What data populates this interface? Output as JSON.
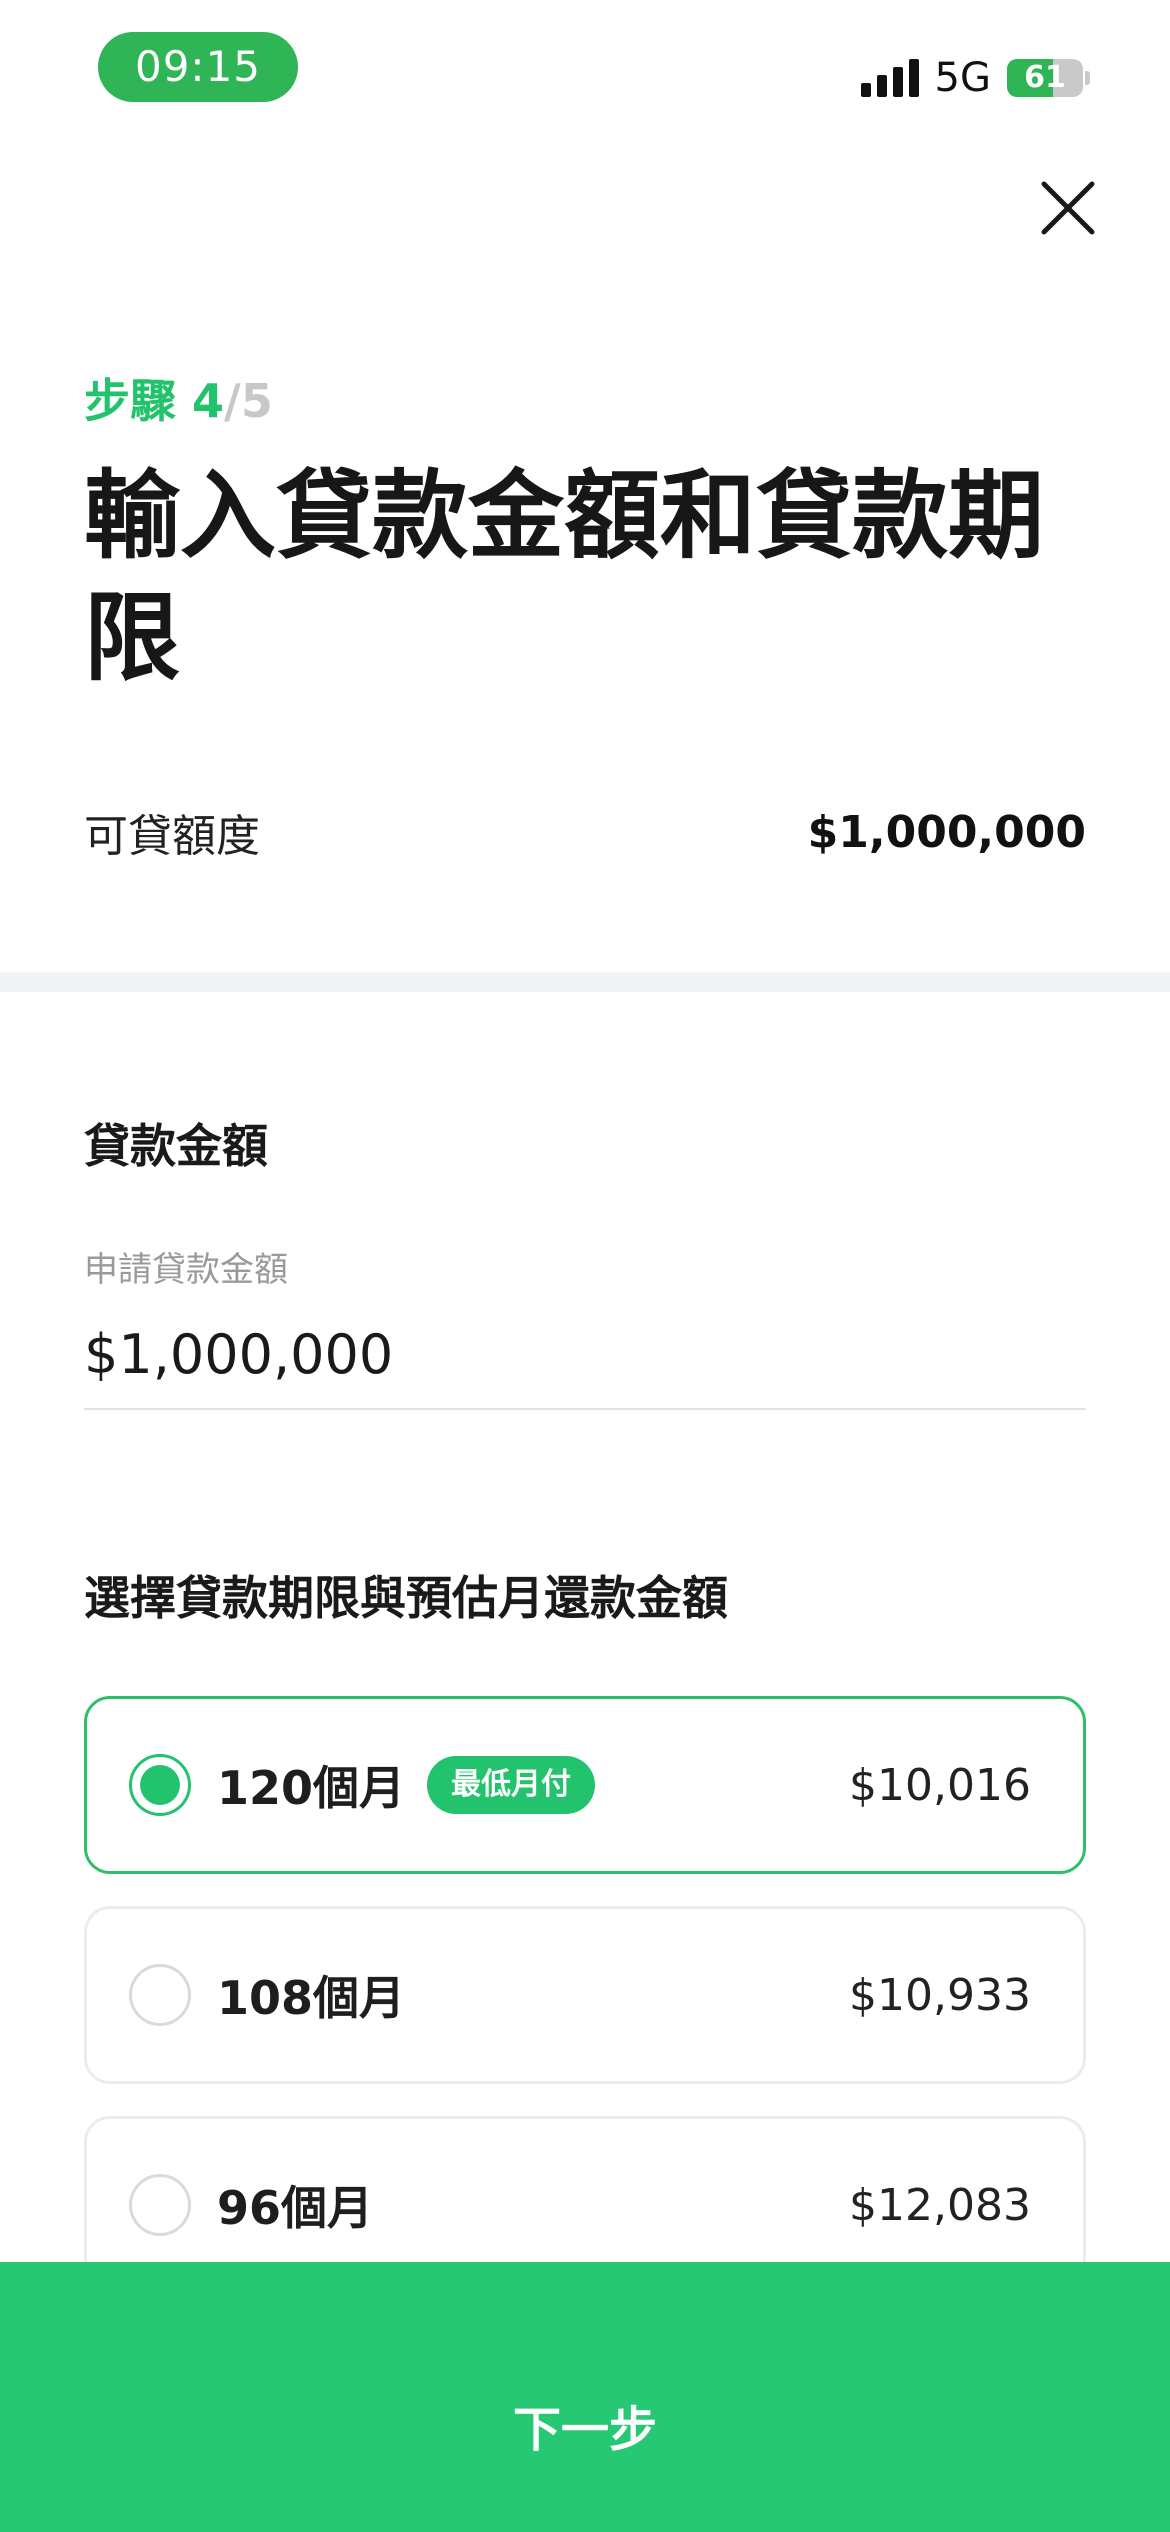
{
  "status_bar": {
    "time": "09:15",
    "network": "5G",
    "battery_level": "61",
    "battery_fraction": 0.61
  },
  "icons": {
    "close": "close-icon",
    "signal": "signal-icon",
    "battery": "battery-icon"
  },
  "header": {
    "step_label": "步驟",
    "step_current": "4",
    "step_total": "/5",
    "title": "輸入貸款金額和貸款期限"
  },
  "limit": {
    "label": "可貸額度",
    "value": "$1,000,000"
  },
  "loan_amount": {
    "section_title": "貸款金額",
    "field_label": "申請貸款金額",
    "value": "$1,000,000"
  },
  "terms": {
    "section_title": "選擇貸款期限與預估月還款金額",
    "options": [
      {
        "term": "120個月",
        "badge": "最低月付",
        "amount": "$10,016",
        "selected": true
      },
      {
        "term": "108個月",
        "badge": "",
        "amount": "$10,933",
        "selected": false
      },
      {
        "term": "96個月",
        "badge": "",
        "amount": "$12,083",
        "selected": false
      }
    ]
  },
  "footer": {
    "next_label": "下一步"
  },
  "colors": {
    "accent": "#22c36c",
    "button": "#26c873",
    "time_pill": "#2fb555"
  }
}
